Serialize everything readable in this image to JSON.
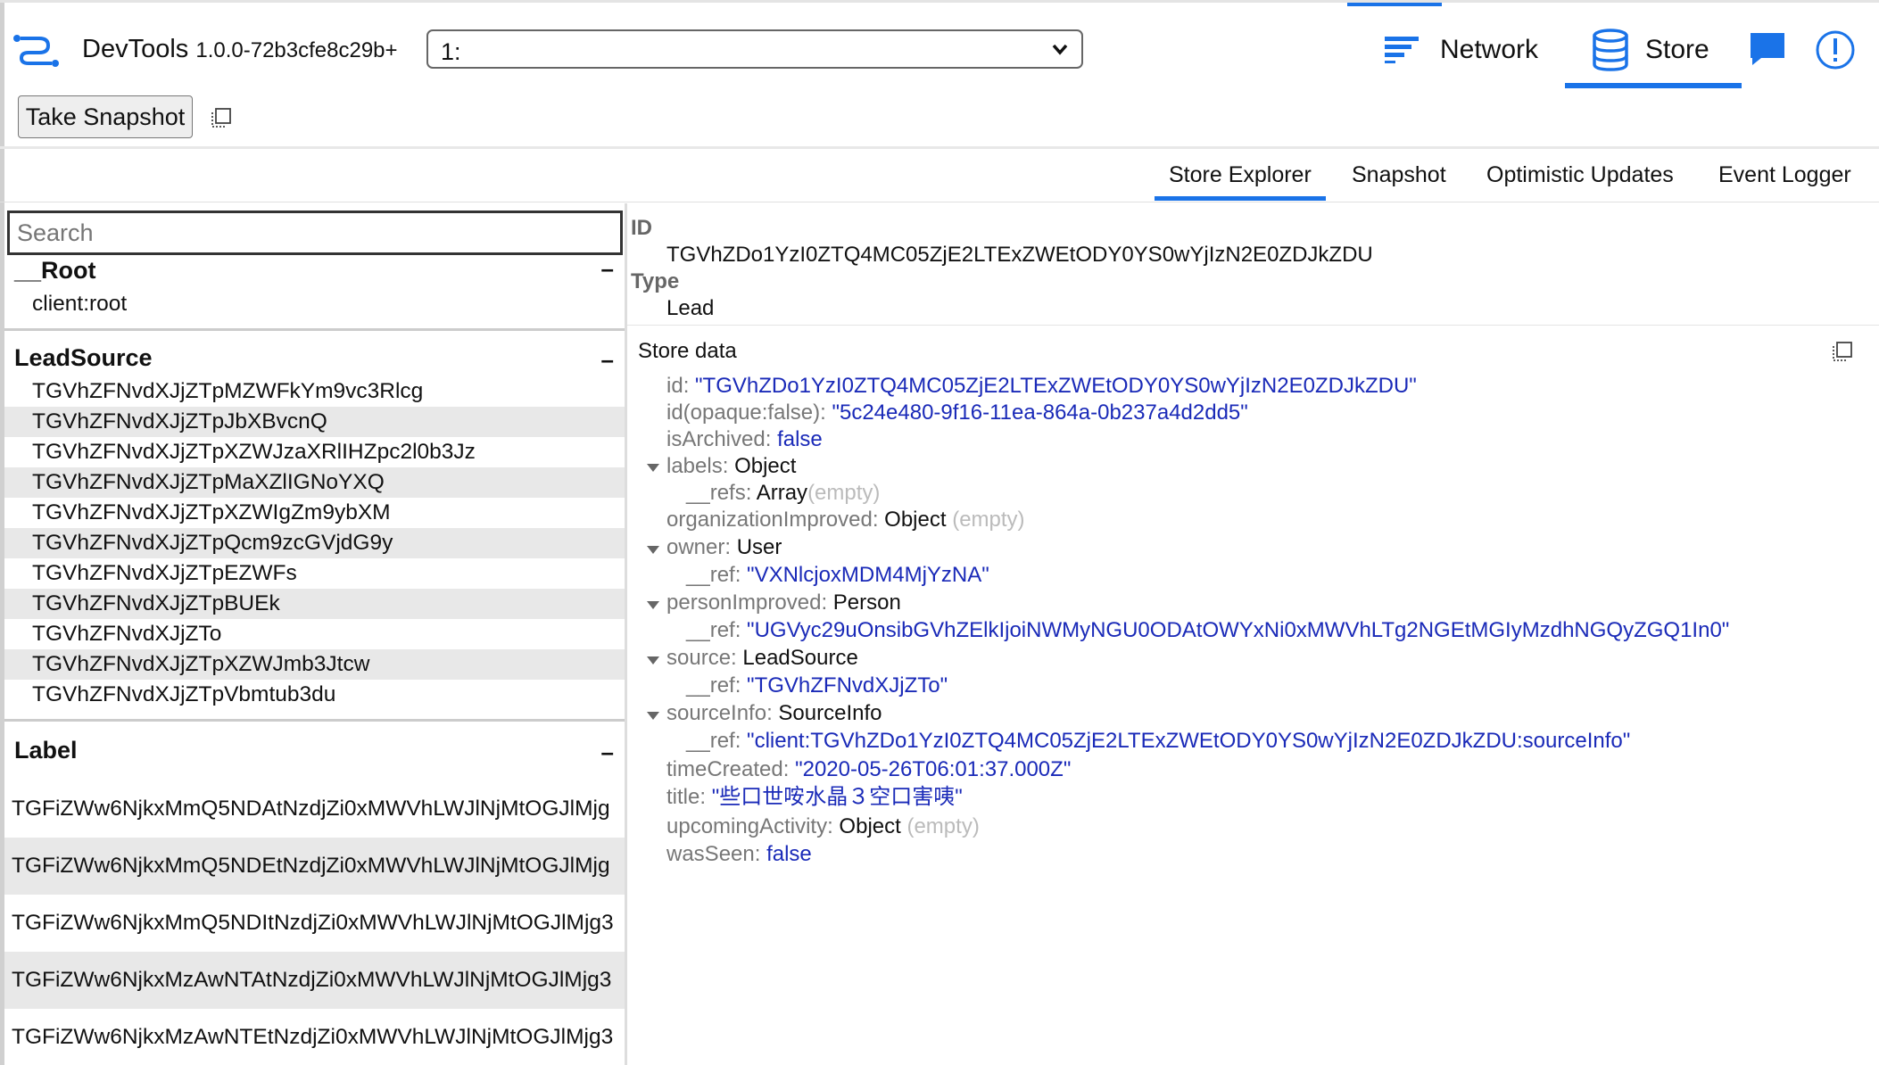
{
  "app": {
    "title": "DevTools",
    "version": "1.0.0-72b3cfe8c29b+"
  },
  "env_select": {
    "value": "1:"
  },
  "nav": {
    "network": "Network",
    "store": "Store"
  },
  "toolbar": {
    "snapshot_label": "Take Snapshot"
  },
  "subtabs": [
    "Store Explorer",
    "Snapshot",
    "Optimistic Updates",
    "Event Logger"
  ],
  "sidebar": {
    "search_placeholder": "Search",
    "root": {
      "title": "__Root",
      "items": [
        "client:root"
      ]
    },
    "leadsource": {
      "title": "LeadSource",
      "items": [
        "TGVhZFNvdXJjZTpMZWFkYm9vc3Rlcg",
        "TGVhZFNvdXJjZTpJbXBvcnQ",
        "TGVhZFNvdXJjZTpXZWJzaXRlIHZpc2l0b3Jz",
        "TGVhZFNvdXJjZTpMaXZlIGNoYXQ",
        "TGVhZFNvdXJjZTpXZWIgZm9ybXM",
        "TGVhZFNvdXJjZTpQcm9zcGVjdG9y",
        "TGVhZFNvdXJjZTpEZWFs",
        "TGVhZFNvdXJjZTpBUEk",
        "TGVhZFNvdXJjZTo",
        "TGVhZFNvdXJjZTpXZWJmb3Jtcw",
        "TGVhZFNvdXJjZTpVbmtub3du"
      ]
    },
    "label": {
      "title": "Label",
      "items": [
        "TGFiZWw6NjkxMmQ5NDAtNzdjZi0xMWVhLWJlNjMtOGJlMjg",
        "TGFiZWw6NjkxMmQ5NDEtNzdjZi0xMWVhLWJlNjMtOGJlMjg",
        "TGFiZWw6NjkxMmQ5NDItNzdjZi0xMWVhLWJlNjMtOGJlMjg3",
        "TGFiZWw6NjkxMzAwNTAtNzdjZi0xMWVhLWJlNjMtOGJlMjg3",
        "TGFiZWw6NjkxMzAwNTEtNzdjZi0xMWVhLWJlNjMtOGJlMjg3"
      ]
    },
    "collapse_symbol": "–"
  },
  "detail": {
    "id_label": "ID",
    "id_value": "TGVhZDo1YzI0ZTQ4MC05ZjE2LTExZWEtODY0YS0wYjIzN2E0ZDJkZDU",
    "type_label": "Type",
    "type_value": "Lead",
    "store_data_label": "Store data",
    "fields": {
      "id_k": "id",
      "id_v": "\"TGVhZDo1YzI0ZTQ4MC05ZjE2LTExZWEtODY0YS0wYjIzN2E0ZDJkZDU\"",
      "opaque_k": "id(opaque:false)",
      "opaque_v": "\"5c24e480-9f16-11ea-864a-0b237a4d2dd5\"",
      "archived_k": "isArchived",
      "archived_v": "false",
      "labels_k": "labels",
      "labels_t": "Object",
      "refs_k": "__refs",
      "refs_t": "Array",
      "refs_e": "(empty)",
      "orgimp_k": "organizationImproved",
      "orgimp_t": "Object",
      "orgimp_e": "(empty)",
      "owner_k": "owner",
      "owner_t": "User",
      "owner_ref_k": "__ref",
      "owner_ref_v": "\"VXNlcjoxMDM4MjYzNA\"",
      "person_k": "personImproved",
      "person_t": "Person",
      "person_ref_k": "__ref",
      "person_ref_v": "\"UGVyc29uOnsibGVhZElkIjoiNWMyNGU0ODAtOWYxNi0xMWVhLTg2NGEtMGIyMzdhNGQyZGQ1In0\"",
      "source_k": "source",
      "source_t": "LeadSource",
      "source_ref_k": "__ref",
      "source_ref_v": "\"TGVhZFNvdXJjZTo\"",
      "srcinfo_k": "sourceInfo",
      "srcinfo_t": "SourceInfo",
      "srcinfo_ref_k": "__ref",
      "srcinfo_ref_v": "\"client:TGVhZDo1YzI0ZTQ4MC05ZjE2LTExZWEtODY0YS0wYjIzN2E0ZDJkZDU:sourceInfo\"",
      "created_k": "timeCreated",
      "created_v": "\"2020-05-26T06:01:37.000Z\"",
      "title_k": "title",
      "title_v": "\"些口世咹水晶３空口害咦\"",
      "upcoming_k": "upcomingActivity",
      "upcoming_t": "Object",
      "upcoming_e": "(empty)",
      "seen_k": "wasSeen",
      "seen_v": "false"
    }
  },
  "colors": {
    "accent": "#1a73e8",
    "value": "#1a2ab8",
    "key": "#777777",
    "empty": "#bbbbbb"
  },
  "icons": [
    "relay-logo-icon",
    "chevron-down-icon",
    "network-lines-icon",
    "database-icon",
    "chat-icon",
    "info-circle-icon",
    "copy-icon"
  ]
}
